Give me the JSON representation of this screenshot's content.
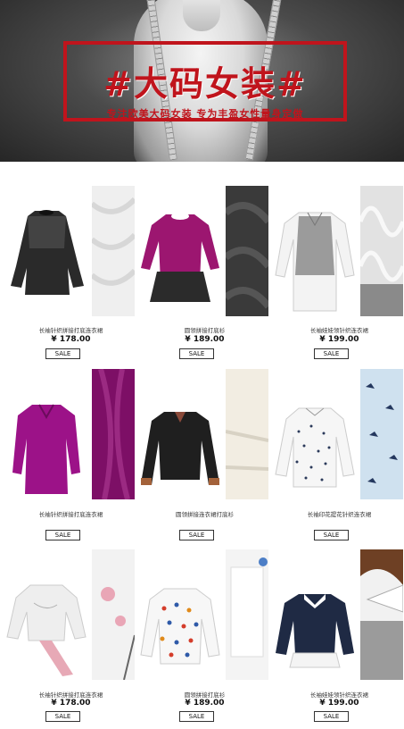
{
  "banner": {
    "title": "#大码女装#",
    "subtitle": "专注欧美大码女装   专为丰盈女性量身定做",
    "accent_color": "#c0141c"
  },
  "products": [
    {
      "name": "长袖针织拼接打底连衣裙",
      "price": "¥ 178.00",
      "sale": "SALE"
    },
    {
      "name": "圆领拼接打底衫",
      "price": "¥ 189.00",
      "sale": "SALE"
    },
    {
      "name": "长袖娃娃领针织连衣裙",
      "price": "¥ 199.00",
      "sale": "SALE"
    },
    {
      "name": "长袖针织拼接打底连衣裙",
      "price": "",
      "sale": "SALE"
    },
    {
      "name": "圆领拼接连衣裙打底衫",
      "price": "",
      "sale": "SALE"
    },
    {
      "name": "长袖印花提花针织连衣裙",
      "price": "",
      "sale": "SALE"
    },
    {
      "name": "长袖针织拼接打底连衣裙",
      "price": "¥ 178.00",
      "sale": "SALE"
    },
    {
      "name": "圆领拼接打底衫",
      "price": "¥ 189.00",
      "sale": "SALE"
    },
    {
      "name": "长袖娃娃领针织连衣裙",
      "price": "¥ 199.00",
      "sale": "SALE"
    }
  ]
}
